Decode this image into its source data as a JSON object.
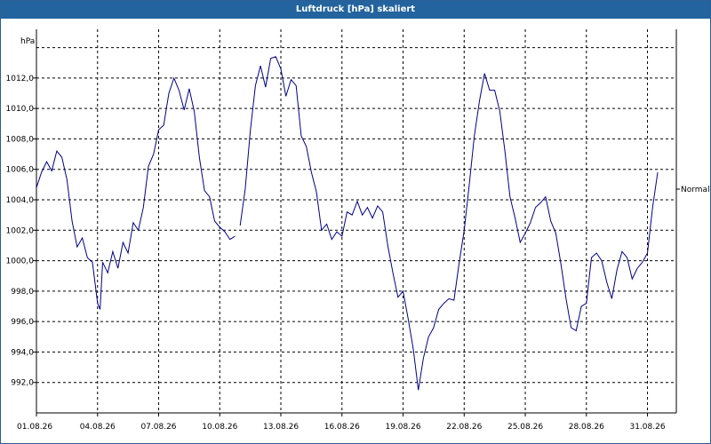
{
  "window": {
    "title": "Luftdruck [hPa] skaliert"
  },
  "chart_data": {
    "type": "line",
    "title": "Luftdruck [hPa] skaliert",
    "ylabel": "hPa",
    "xlabel": "",
    "ylim": [
      990.0,
      1015.2
    ],
    "xlim": [
      "01.08.26",
      "01.09.26 10:00"
    ],
    "grid": true,
    "y_ticks": [
      "992,0",
      "994,0",
      "996,0",
      "998,0",
      "1000,0",
      "1002,0",
      "1004,0",
      "1006,0",
      "1008,0",
      "1010,0",
      "1012,0"
    ],
    "x_ticks": [
      "01.08.26",
      "04.08.26",
      "07.08.26",
      "10.08.26",
      "13.08.26",
      "16.08.26",
      "19.08.26",
      "22.08.26",
      "25.08.26",
      "28.08.26",
      "31.08.26"
    ],
    "series": [
      {
        "name": "Normal",
        "color": "#00008b",
        "segments": [
          [
            [
              "01.08.26 00:00",
              1004.8
            ],
            [
              "01.08.26 06:00",
              1005.8
            ],
            [
              "01.08.26 12:00",
              1006.5
            ],
            [
              "01.08.26 18:00",
              1005.9
            ],
            [
              "02.08.26 00:00",
              1007.2
            ],
            [
              "02.08.26 06:00",
              1006.8
            ],
            [
              "02.08.26 12:00",
              1005.3
            ],
            [
              "02.08.26 18:00",
              1002.6
            ],
            [
              "03.08.26 00:00",
              1000.9
            ],
            [
              "03.08.26 06:00",
              1001.5
            ],
            [
              "03.08.26 12:00",
              1000.2
            ],
            [
              "03.08.26 18:00",
              999.9
            ],
            [
              "04.08.26 00:00",
              997.2
            ],
            [
              "04.08.26 03:00",
              996.8
            ],
            [
              "04.08.26 06:00",
              999.9
            ],
            [
              "04.08.26 12:00",
              999.2
            ],
            [
              "04.08.26 18:00",
              1000.6
            ],
            [
              "05.08.26 00:00",
              999.5
            ],
            [
              "05.08.26 06:00",
              1001.2
            ],
            [
              "05.08.26 12:00",
              1000.5
            ],
            [
              "05.08.26 18:00",
              1002.5
            ],
            [
              "06.08.26 00:00",
              1002.0
            ],
            [
              "06.08.26 06:00",
              1003.5
            ],
            [
              "06.08.26 12:00",
              1006.2
            ],
            [
              "06.08.26 18:00",
              1007.0
            ],
            [
              "07.08.26 00:00",
              1008.6
            ],
            [
              "07.08.26 06:00",
              1008.9
            ],
            [
              "07.08.26 12:00",
              1011.0
            ],
            [
              "07.08.26 18:00",
              1012.0
            ],
            [
              "08.08.26 00:00",
              1011.2
            ],
            [
              "08.08.26 06:00",
              1009.9
            ],
            [
              "08.08.26 12:00",
              1011.3
            ],
            [
              "08.08.26 18:00",
              1009.8
            ],
            [
              "09.08.26 00:00",
              1006.8
            ],
            [
              "09.08.26 06:00",
              1004.6
            ],
            [
              "09.08.26 12:00",
              1004.2
            ],
            [
              "09.08.26 18:00",
              1002.6
            ],
            [
              "10.08.26 00:00",
              1002.2
            ],
            [
              "10.08.26 06:00",
              1001.9
            ],
            [
              "10.08.26 12:00",
              1001.4
            ],
            [
              "10.08.26 18:00",
              1001.6
            ]
          ],
          [
            [
              "11.08.26 00:00",
              1002.3
            ],
            [
              "11.08.26 06:00",
              1004.7
            ],
            [
              "11.08.26 12:00",
              1008.5
            ],
            [
              "11.08.26 18:00",
              1011.5
            ],
            [
              "12.08.26 00:00",
              1012.8
            ],
            [
              "12.08.26 06:00",
              1011.4
            ],
            [
              "12.08.26 12:00",
              1013.3
            ],
            [
              "12.08.26 18:00",
              1013.4
            ],
            [
              "13.08.26 00:00",
              1012.6
            ],
            [
              "13.08.26 06:00",
              1010.8
            ],
            [
              "13.08.26 12:00",
              1011.9
            ],
            [
              "13.08.26 18:00",
              1011.5
            ],
            [
              "14.08.26 00:00",
              1008.2
            ],
            [
              "14.08.26 06:00",
              1007.5
            ],
            [
              "14.08.26 12:00",
              1005.8
            ],
            [
              "14.08.26 18:00",
              1004.5
            ],
            [
              "15.08.26 00:00",
              1002.0
            ],
            [
              "15.08.26 06:00",
              1002.4
            ],
            [
              "15.08.26 12:00",
              1001.4
            ],
            [
              "15.08.26 18:00",
              1001.9
            ],
            [
              "16.08.26 00:00",
              1001.6
            ],
            [
              "16.08.26 06:00",
              1003.2
            ],
            [
              "16.08.26 12:00",
              1003.0
            ],
            [
              "16.08.26 18:00",
              1003.9
            ],
            [
              "17.08.26 00:00",
              1003.0
            ],
            [
              "17.08.26 06:00",
              1003.5
            ],
            [
              "17.08.26 12:00",
              1002.8
            ],
            [
              "17.08.26 18:00",
              1003.6
            ],
            [
              "18.08.26 00:00",
              1003.2
            ],
            [
              "18.08.26 06:00",
              1001.0
            ],
            [
              "18.08.26 12:00",
              999.2
            ],
            [
              "18.08.26 18:00",
              997.6
            ],
            [
              "19.08.26 00:00",
              998.0
            ],
            [
              "19.08.26 06:00",
              996.2
            ],
            [
              "19.08.26 12:00",
              994.2
            ],
            [
              "19.08.26 18:00",
              991.5
            ],
            [
              "20.08.26 00:00",
              993.6
            ],
            [
              "20.08.26 06:00",
              995.0
            ],
            [
              "20.08.26 12:00",
              995.6
            ],
            [
              "20.08.26 18:00",
              996.8
            ],
            [
              "21.08.26 00:00",
              997.2
            ],
            [
              "21.08.26 06:00",
              997.5
            ],
            [
              "21.08.26 12:00",
              997.4
            ],
            [
              "21.08.26 18:00",
              999.8
            ],
            [
              "22.08.26 00:00",
              1002.0
            ],
            [
              "22.08.26 06:00",
              1005.0
            ],
            [
              "22.08.26 12:00",
              1008.2
            ],
            [
              "22.08.26 18:00",
              1010.5
            ],
            [
              "23.08.26 00:00",
              1012.3
            ],
            [
              "23.08.26 06:00",
              1011.2
            ],
            [
              "23.08.26 12:00",
              1011.2
            ],
            [
              "23.08.26 18:00",
              1009.8
            ],
            [
              "24.08.26 00:00",
              1007.2
            ],
            [
              "24.08.26 06:00",
              1004.2
            ],
            [
              "24.08.26 12:00",
              1002.8
            ],
            [
              "24.08.26 18:00",
              1001.2
            ],
            [
              "25.08.26 00:00",
              1001.8
            ],
            [
              "25.08.26 06:00",
              1002.5
            ],
            [
              "25.08.26 12:00",
              1003.5
            ],
            [
              "25.08.26 18:00",
              1003.8
            ],
            [
              "26.08.26 00:00",
              1004.2
            ],
            [
              "26.08.26 06:00",
              1002.6
            ],
            [
              "26.08.26 12:00",
              1001.8
            ],
            [
              "26.08.26 18:00",
              999.8
            ],
            [
              "27.08.26 00:00",
              997.5
            ],
            [
              "27.08.26 06:00",
              995.6
            ],
            [
              "27.08.26 12:00",
              995.4
            ],
            [
              "27.08.26 18:00",
              997.0
            ],
            [
              "28.08.26 00:00",
              997.2
            ],
            [
              "28.08.26 06:00",
              1000.2
            ],
            [
              "28.08.26 12:00",
              1000.5
            ],
            [
              "28.08.26 18:00",
              1000.0
            ],
            [
              "29.08.26 00:00",
              998.6
            ],
            [
              "29.08.26 06:00",
              997.5
            ],
            [
              "29.08.26 12:00",
              999.4
            ],
            [
              "29.08.26 18:00",
              1000.6
            ],
            [
              "30.08.26 00:00",
              1000.2
            ],
            [
              "30.08.26 06:00",
              998.8
            ],
            [
              "30.08.26 12:00",
              999.5
            ],
            [
              "30.08.26 18:00",
              999.9
            ],
            [
              "31.08.26 00:00",
              1000.5
            ],
            [
              "31.08.26 06:00",
              1003.5
            ],
            [
              "31.08.26 12:00",
              1005.8
            ]
          ]
        ]
      }
    ],
    "legend": "end-of-line label"
  }
}
